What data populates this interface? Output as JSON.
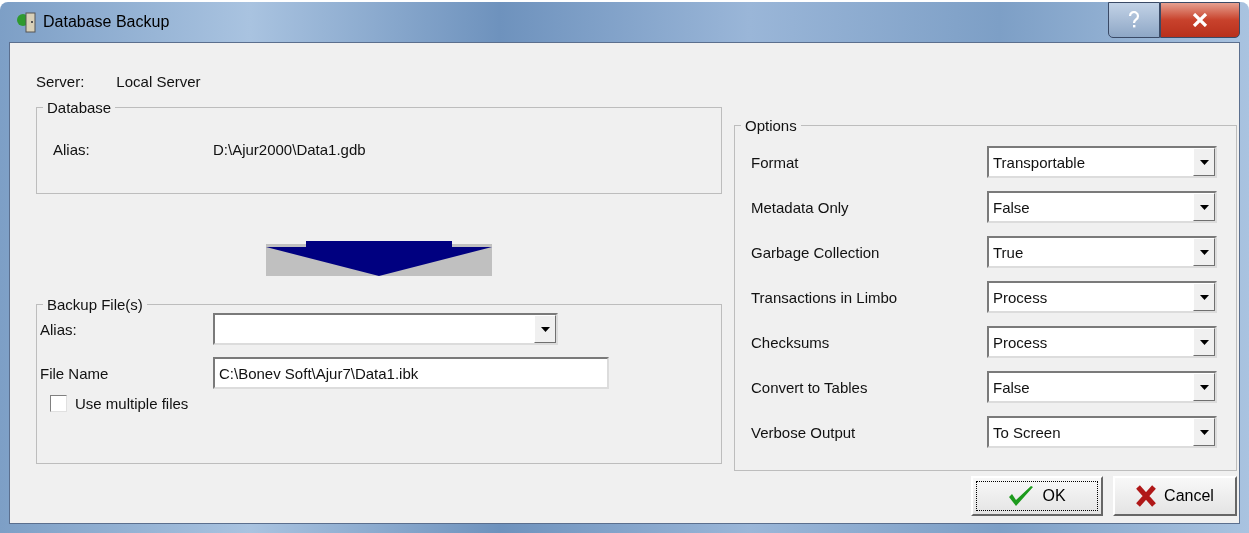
{
  "window": {
    "title": "Database Backup"
  },
  "server": {
    "label": "Server:",
    "value": "Local Server"
  },
  "database": {
    "title": "Database",
    "alias_label": "Alias:",
    "alias_value": "D:\\Ajur2000\\Data1.gdb"
  },
  "backup_files": {
    "title": "Backup File(s)",
    "alias": {
      "label": "Alias:"
    },
    "file_name": {
      "label": "File Name",
      "value": "C:\\Bonev Soft\\Ajur7\\Data1.ibk"
    },
    "use_multiple_files": {
      "label": "Use multiple files",
      "checked": false
    }
  },
  "options": {
    "title": "Options",
    "rows": [
      {
        "label": "Format",
        "value": "Transportable"
      },
      {
        "label": "Metadata Only",
        "value": "False"
      },
      {
        "label": "Garbage Collection",
        "value": "True"
      },
      {
        "label": "Transactions in Limbo",
        "value": "Process"
      },
      {
        "label": "Checksums",
        "value": "Process"
      },
      {
        "label": "Convert to Tables",
        "value": "False"
      },
      {
        "label": "Verbose Output",
        "value": "To Screen"
      }
    ]
  },
  "buttons": [
    {
      "label": "OK",
      "kind": "ok",
      "focused": true
    },
    {
      "label": "Cancel",
      "kind": "cancel",
      "focused": false
    }
  ]
}
